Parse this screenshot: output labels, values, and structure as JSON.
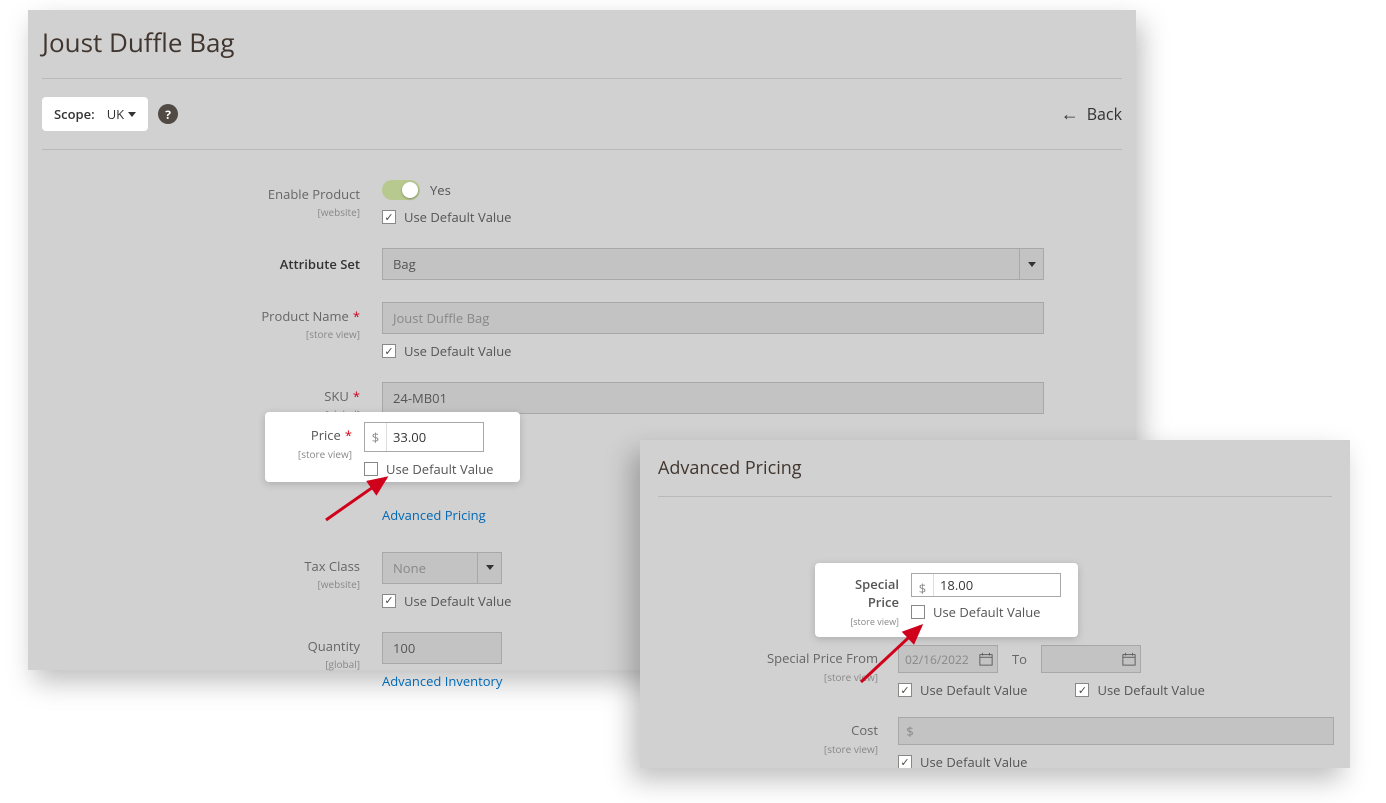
{
  "page": {
    "title": "Joust Duffle Bag"
  },
  "scope": {
    "label": "Scope:",
    "value": "UK"
  },
  "back": {
    "label": "Back"
  },
  "common": {
    "use_default": "Use Default Value"
  },
  "fields": {
    "enable": {
      "label": "Enable Product",
      "scope": "[website]",
      "toggle": "Yes"
    },
    "attr_set": {
      "label": "Attribute Set",
      "value": "Bag"
    },
    "name": {
      "label": "Product Name",
      "scope": "[store view]",
      "value": "Joust Duffle Bag"
    },
    "sku": {
      "label": "SKU",
      "scope": "[global]",
      "value": "24-MB01"
    },
    "price": {
      "label": "Price",
      "scope": "[store view]",
      "currency": "$",
      "value": "33.00",
      "adv_link": "Advanced Pricing"
    },
    "tax": {
      "label": "Tax Class",
      "scope": "[website]",
      "value": "None"
    },
    "qty": {
      "label": "Quantity",
      "scope": "[global]",
      "value": "100",
      "adv_link": "Advanced Inventory"
    }
  },
  "adv": {
    "title": "Advanced Pricing",
    "special_price": {
      "label": "Special Price",
      "scope": "[store view]",
      "currency": "$",
      "value": "18.00"
    },
    "from": {
      "label": "Special Price From",
      "scope": "[store view]",
      "value": "02/16/2022",
      "to_label": "To",
      "to_value": ""
    },
    "cost": {
      "label": "Cost",
      "scope": "[store view]",
      "currency": "$"
    }
  }
}
